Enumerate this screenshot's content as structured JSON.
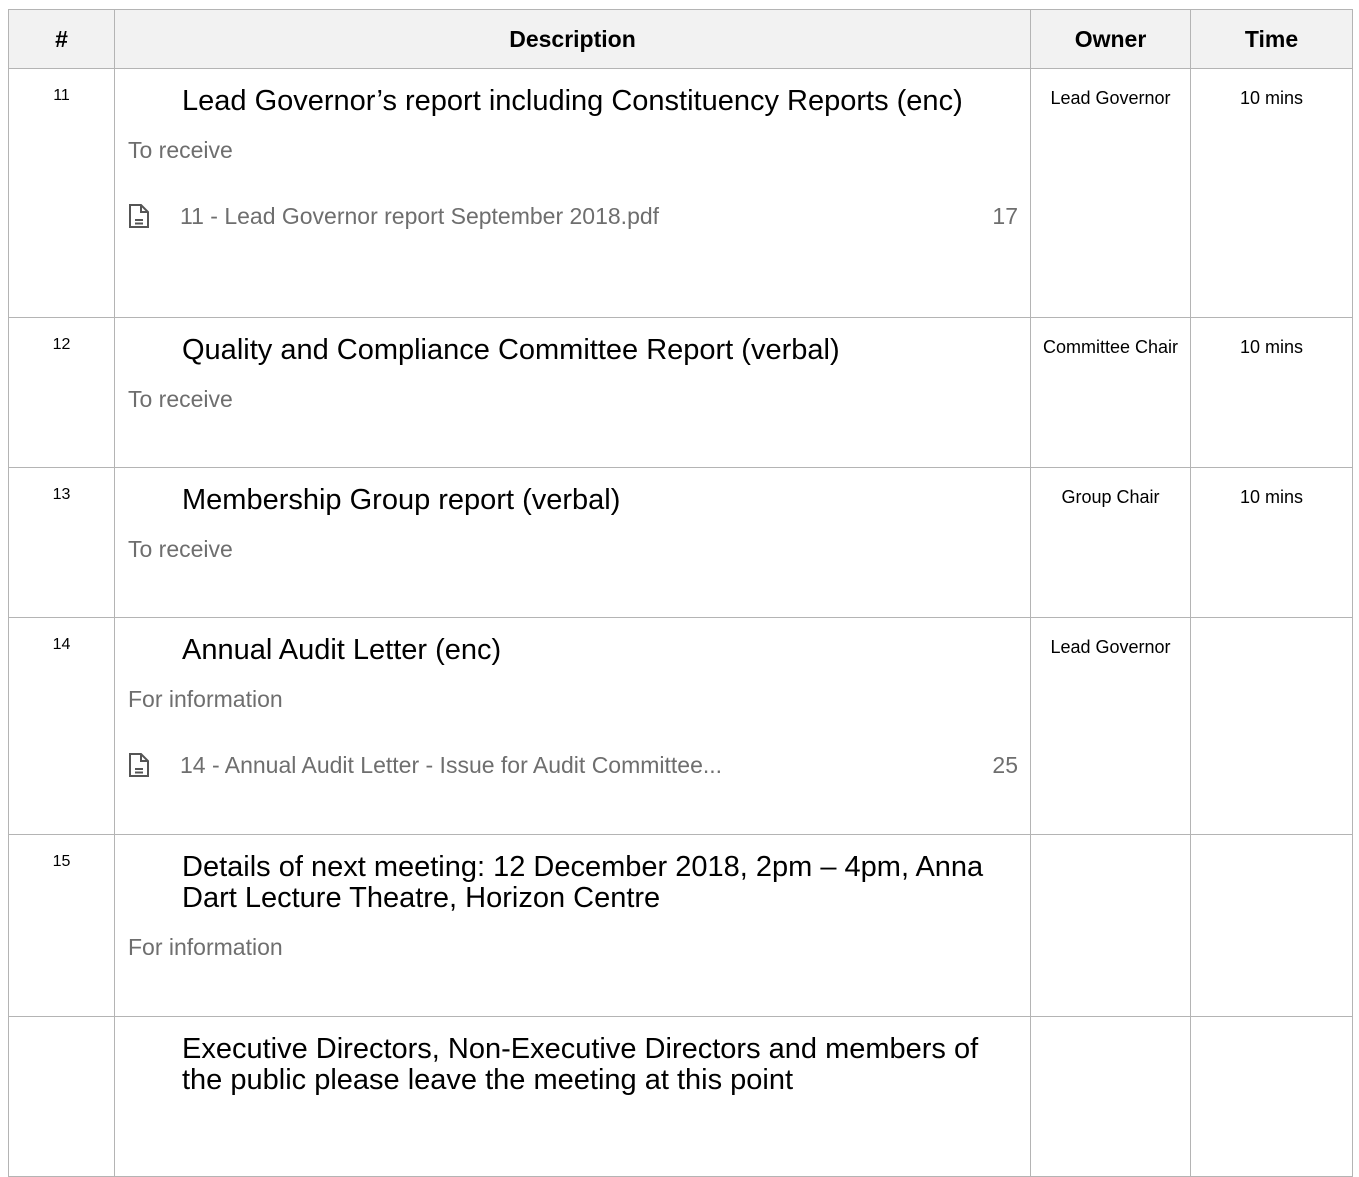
{
  "headers": {
    "num": "#",
    "description": "Description",
    "owner": "Owner",
    "time": "Time"
  },
  "rows": [
    {
      "num": "11",
      "title": "Lead Governor’s report including Constituency Reports (enc)",
      "purpose": "To receive",
      "owner": "Lead Governor",
      "time": "10 mins",
      "attachment": {
        "name": "11 - Lead Governor report September 2018.pdf",
        "page": "17"
      }
    },
    {
      "num": "12",
      "title": "Quality and Compliance Committee Report (verbal)",
      "purpose": "To receive",
      "owner": "Committee Chair",
      "time": "10 mins"
    },
    {
      "num": "13",
      "title": "Membership Group report (verbal)",
      "purpose": "To receive",
      "owner": "Group Chair",
      "time": "10 mins"
    },
    {
      "num": "14",
      "title": "Annual Audit Letter (enc)",
      "purpose": "For information",
      "owner": "Lead Governor",
      "time": "",
      "attachment": {
        "name": "14 - Annual Audit Letter - Issue for Audit Committee...",
        "page": "25"
      }
    },
    {
      "num": "15",
      "title": "Details of next meeting: 12 December 2018, 2pm – 4pm, Anna Dart Lecture Theatre, Horizon Centre",
      "purpose": "For information",
      "owner": "",
      "time": ""
    },
    {
      "num": "",
      "title": "Executive Directors, Non-Executive Directors and members of the public please leave the meeting at this point",
      "purpose": "",
      "owner": "",
      "time": ""
    }
  ],
  "icons": {
    "attachment": "document-icon"
  },
  "colors": {
    "border": "#b4b4b4",
    "header_bg": "#f2f2f2",
    "muted_text": "#6e6e6e"
  }
}
